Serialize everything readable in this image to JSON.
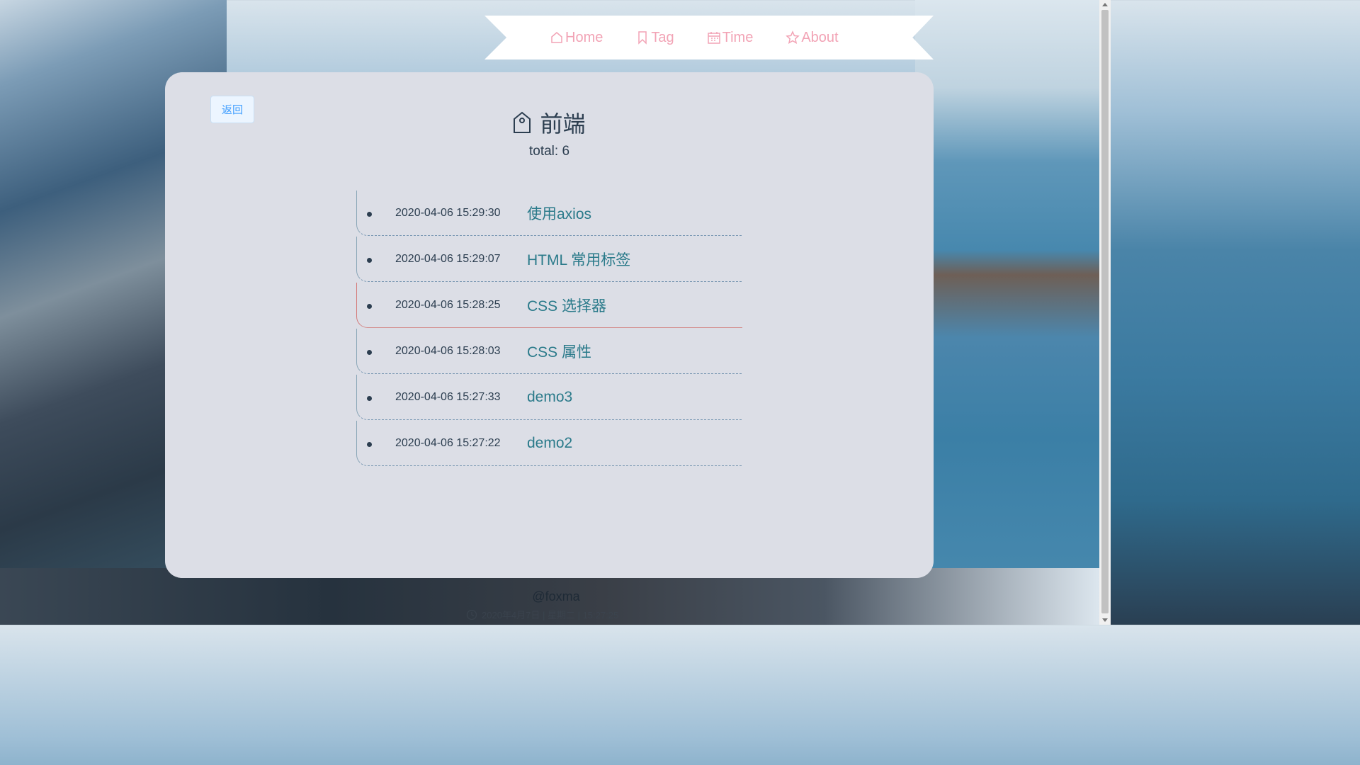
{
  "nav": {
    "items": [
      {
        "label": "Home",
        "icon": "home-icon"
      },
      {
        "label": "Tag",
        "icon": "bookmark-icon"
      },
      {
        "label": "Time",
        "icon": "calendar-icon"
      },
      {
        "label": "About",
        "icon": "star-icon"
      }
    ],
    "color": "#f2a3b5"
  },
  "card": {
    "back_label": "返回",
    "tag_name": "前端",
    "total_label": "total: 6"
  },
  "posts": [
    {
      "date": "2020-04-06 15:29:30",
      "title": "使用axios"
    },
    {
      "date": "2020-04-06 15:29:07",
      "title": "HTML 常用标签"
    },
    {
      "date": "2020-04-06 15:28:25",
      "title": "CSS 选择器"
    },
    {
      "date": "2020-04-06 15:28:03",
      "title": "CSS 属性"
    },
    {
      "date": "2020-04-06 15:27:33",
      "title": "demo3"
    },
    {
      "date": "2020-04-06 15:27:22",
      "title": "demo2"
    }
  ],
  "footer": {
    "email": "@foxma",
    "datetime": "2020年4月7日 | 星期二 | 15:27:25"
  },
  "colors": {
    "card_bg": "#dcdee6",
    "title_link": "#2a7a8a",
    "active_line": "#d47a7a"
  }
}
